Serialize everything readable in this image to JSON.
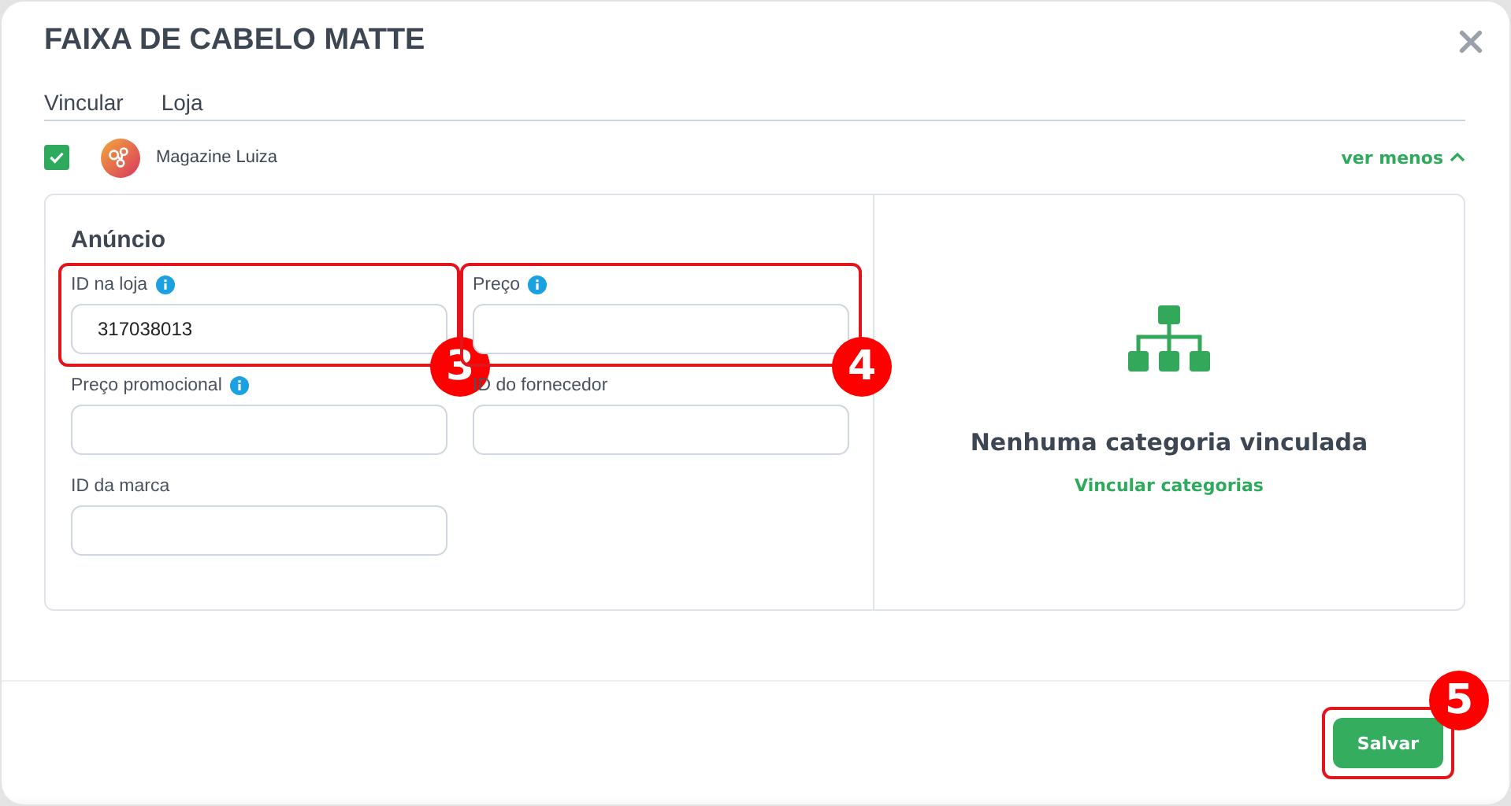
{
  "window": {
    "title": "FAIXA DE CABELO MATTE"
  },
  "columns": [
    {
      "label": "Vincular"
    },
    {
      "label": "Loja"
    }
  ],
  "store": {
    "checked": true,
    "name": "Magazine Luiza",
    "toggle": "ver menos",
    "expanded": true
  },
  "ad": {
    "title": "Anúncio",
    "fields": [
      {
        "label": "ID na loja",
        "info": true,
        "value": "317038013",
        "callout": "3"
      },
      {
        "label": "Preço",
        "info": true,
        "callout": "4"
      },
      {
        "label": "Preço promocional",
        "info": true
      },
      {
        "label": "ID do fornecedor",
        "info": false
      },
      {
        "label": "ID da marca",
        "info": false
      }
    ]
  },
  "categories": {
    "empty_text": "Nenhuma categoria vinculada",
    "link": "Vincular categorias"
  },
  "save_button": {
    "label": "Salvar",
    "callout": "5"
  }
}
